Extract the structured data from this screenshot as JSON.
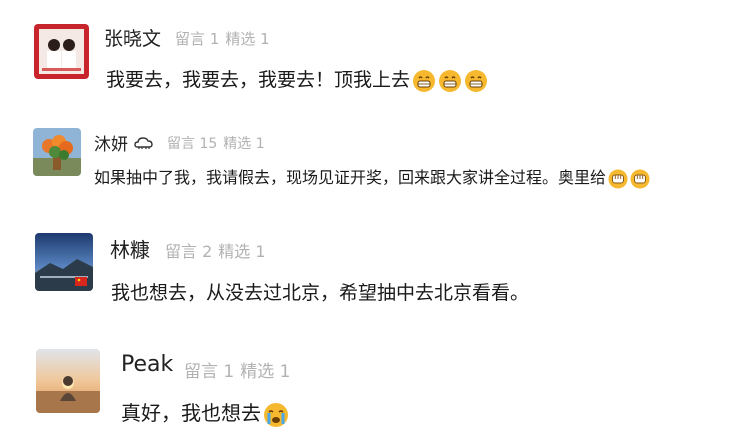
{
  "comments": [
    {
      "user": "张晓文",
      "replies_label": "留言 1",
      "featured_label": "精选 1",
      "text": "我要去，我要去，我要去！顶我上去",
      "emoji": [
        "grin-emoji",
        "grin-emoji",
        "grin-emoji"
      ]
    },
    {
      "user": "沐妍",
      "replies_label": "留言 15",
      "featured_label": "精选 1",
      "text": "如果抽中了我，我请假去，现场见证开奖，回来跟大家讲全过程。奥里给",
      "emoji": [
        "fist-emoji",
        "fist-emoji"
      ]
    },
    {
      "user": "林糠",
      "replies_label": "留言 2",
      "featured_label": "精选 1",
      "text": "我也想去，从没去过北京，希望抽中去北京看看。",
      "emoji": []
    },
    {
      "user": "Peak",
      "replies_label": "留言 1",
      "featured_label": "精选 1",
      "text": "真好，我也想去",
      "emoji": [
        "crying-emoji"
      ]
    }
  ],
  "colors": {
    "meta": "#b2b2b2",
    "emoji": "#f5b82e"
  }
}
